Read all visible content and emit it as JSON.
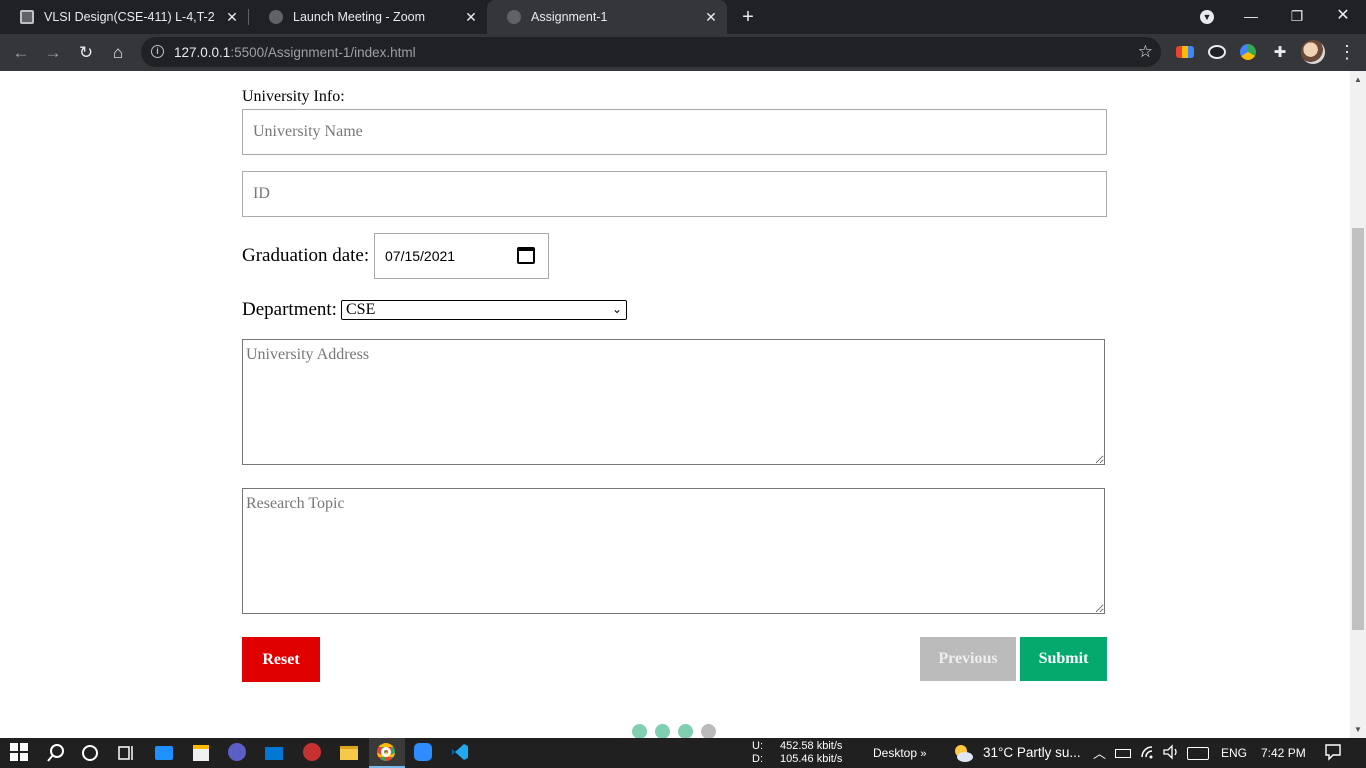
{
  "browser": {
    "tabs": [
      {
        "title": "VLSI Design(CSE-411) L-4,T-2",
        "active": false
      },
      {
        "title": "Launch Meeting - Zoom",
        "active": false
      },
      {
        "title": "Assignment-1",
        "active": true
      }
    ],
    "url_host": "127.0.0.1",
    "url_path": ":5500/Assignment-1/index.html"
  },
  "form": {
    "university_info_label": "University Info:",
    "university_name_placeholder": "University Name",
    "id_placeholder": "ID",
    "graduation_label": "Graduation date:",
    "graduation_value": "07/15/2021",
    "department_label": "Department:",
    "department_value": "CSE",
    "address_placeholder": "University Address",
    "research_placeholder": "Research Topic",
    "reset_label": "Reset",
    "previous_label": "Previous",
    "submit_label": "Submit",
    "steps": [
      {
        "state": "done",
        "color": "#7fcfb0"
      },
      {
        "state": "done",
        "color": "#7fcfb0"
      },
      {
        "state": "done",
        "color": "#7fcfb0"
      },
      {
        "state": "current",
        "color": "#bbbbbb"
      }
    ]
  },
  "taskbar": {
    "upload_label": "U:",
    "upload_value": "452.58 kbit/s",
    "download_label": "D:",
    "download_value": "105.46 kbit/s",
    "desktop_label": "Desktop",
    "weather": "31°C  Partly su...",
    "language": "ENG",
    "time": "7:42 PM"
  },
  "colors": {
    "reset": "#e00000",
    "submit": "#04aa6d",
    "previous": "#bbbbbb"
  }
}
